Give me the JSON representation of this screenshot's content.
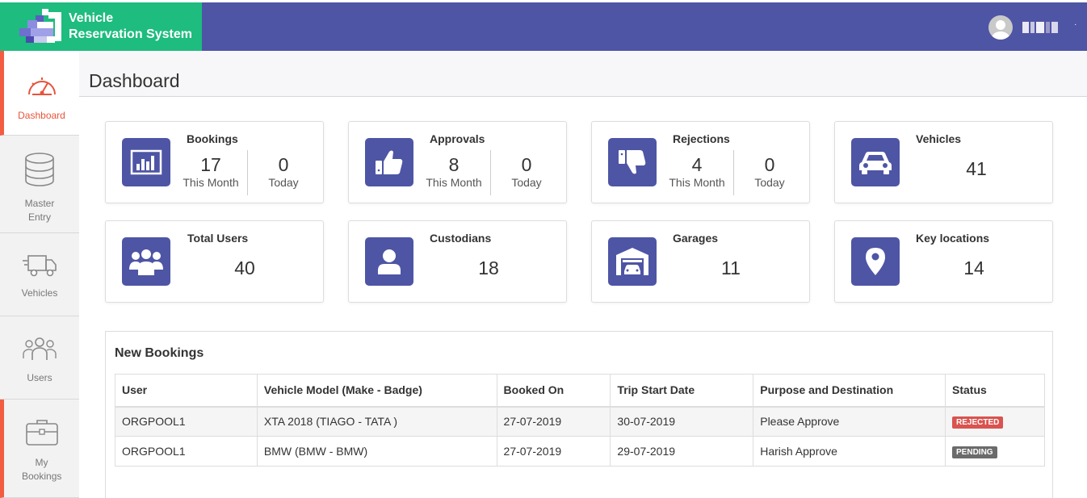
{
  "app": {
    "title_line1": "Vehicle",
    "title_line2": "Reservation System"
  },
  "colors": {
    "brand": "#1ebc7e",
    "topbar": "#4e55a5",
    "accent": "#f25d42",
    "rejected": "#d9534f",
    "pending": "#6b6b6b"
  },
  "sidebar": {
    "items": [
      {
        "label": "Dashboard",
        "icon": "speedometer-icon"
      },
      {
        "label": "Master Entry",
        "icon": "database-icon"
      },
      {
        "label": "Vehicles",
        "icon": "truck-icon"
      },
      {
        "label": "Users",
        "icon": "users-icon"
      },
      {
        "label": "My Bookings",
        "icon": "briefcase-icon"
      }
    ]
  },
  "page": {
    "title": "Dashboard"
  },
  "cards": {
    "bookings": {
      "title": "Bookings",
      "month": "17",
      "today": "0",
      "month_label": "This Month",
      "today_label": "Today",
      "icon": "bar-chart-icon"
    },
    "approvals": {
      "title": "Approvals",
      "month": "8",
      "today": "0",
      "month_label": "This Month",
      "today_label": "Today",
      "icon": "thumbs-up-icon"
    },
    "rejections": {
      "title": "Rejections",
      "month": "4",
      "today": "0",
      "month_label": "This Month",
      "today_label": "Today",
      "icon": "thumbs-down-icon"
    },
    "vehicles": {
      "title": "Vehicles",
      "value": "41",
      "icon": "car-icon"
    },
    "total_users": {
      "title": "Total Users",
      "value": "40",
      "icon": "group-icon"
    },
    "custodians": {
      "title": "Custodians",
      "value": "18",
      "icon": "user-icon"
    },
    "garages": {
      "title": "Garages",
      "value": "11",
      "icon": "garage-icon"
    },
    "key_locations": {
      "title": "Key locations",
      "value": "14",
      "icon": "map-pin-icon"
    }
  },
  "new_bookings": {
    "title": "New Bookings",
    "columns": [
      "User",
      "Vehicle Model (Make - Badge)",
      "Booked On",
      "Trip Start Date",
      "Purpose and Destination",
      "Status"
    ],
    "rows": [
      {
        "user": "ORGPOOL1",
        "model": "XTA 2018 (TIAGO - TATA )",
        "booked_on": "27-07-2019",
        "trip_start": "30-07-2019",
        "purpose": "Please Approve",
        "status": "REJECTED"
      },
      {
        "user": "ORGPOOL1",
        "model": "BMW (BMW - BMW)",
        "booked_on": "27-07-2019",
        "trip_start": "29-07-2019",
        "purpose": "Harish Approve",
        "status": "PENDING"
      }
    ]
  }
}
